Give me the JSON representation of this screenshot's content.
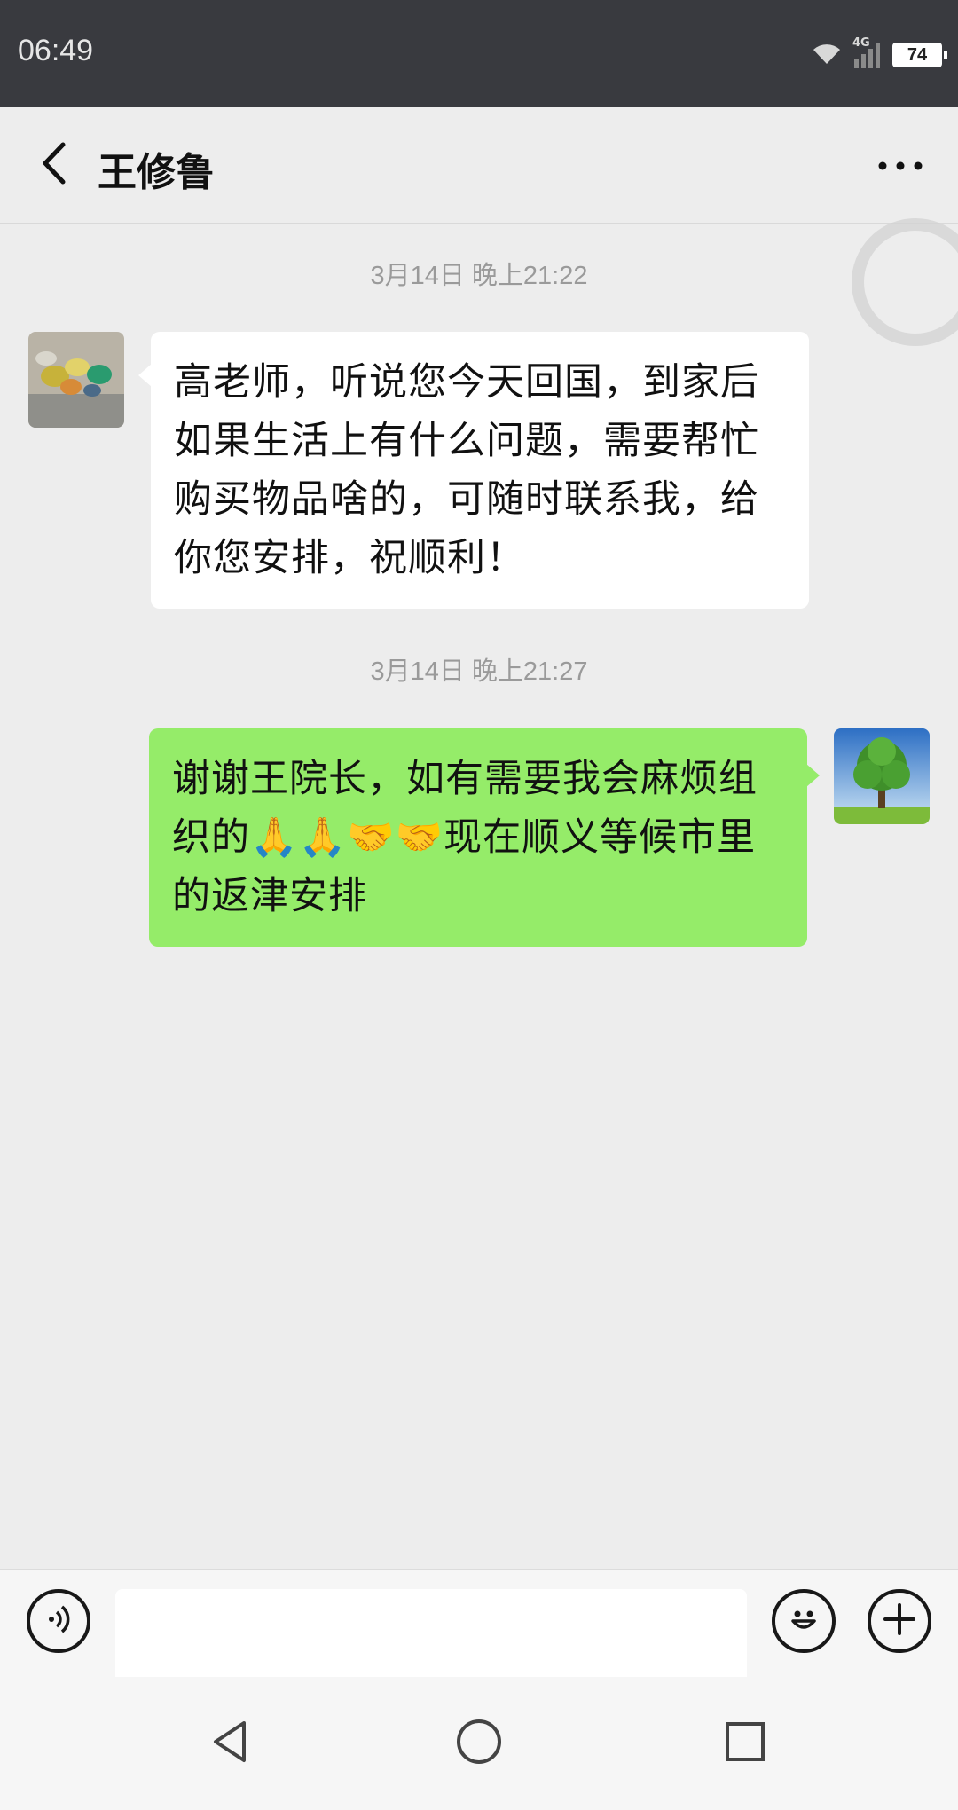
{
  "status_bar": {
    "time": "06:49",
    "network": "4G",
    "battery": "74"
  },
  "header": {
    "title": "王修鲁"
  },
  "messages": [
    {
      "timestamp": "3月14日 晚上21:22",
      "direction": "in",
      "text": "高老师，听说您今天回国，到家后如果生活上有什么问题，需要帮忙购买物品啥的，可随时联系我，给你您安排，祝顺利！"
    },
    {
      "timestamp": "3月14日 晚上21:27",
      "direction": "out",
      "text": "谢谢王院长，如有需要我会麻烦组织的🙏🙏🤝🤝现在顺义等候市里的返津安排"
    }
  ],
  "input": {
    "value": "",
    "placeholder": ""
  },
  "colors": {
    "outgoing_bubble": "#95ec69",
    "incoming_bubble": "#ffffff",
    "background": "#ededed",
    "status_bar": "#393a3f"
  },
  "icons": [
    "back-arrow-icon",
    "more-icon",
    "voice-icon",
    "emoji-icon",
    "plus-icon",
    "nav-back-icon",
    "nav-home-icon",
    "nav-recents-icon"
  ]
}
